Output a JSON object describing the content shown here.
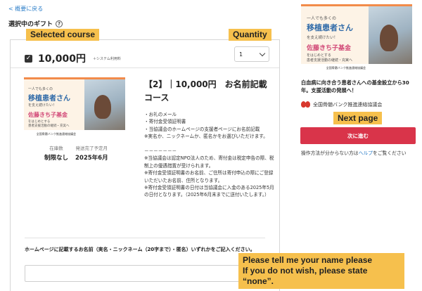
{
  "nav": {
    "back_label": "< 概要に戻る"
  },
  "section": {
    "title": "選択中のギフト",
    "help_icon": "question-circle-icon"
  },
  "annotations": {
    "selected_course": "Selected course",
    "quantity": "Quantity",
    "next_page": "Next page",
    "name_line1": "Please tell me your name please",
    "name_line2": "If you do not wish, please state “none”."
  },
  "course": {
    "checked": true,
    "price": "10,000円",
    "price_note": "＋システム利用料",
    "title": "【2】｜10,000円　お名前記載コース",
    "remaining_label": "在庫数",
    "remaining_value": "制限なし",
    "ship_label": "発送完了予定月",
    "ship_value": "2025年6月",
    "details": "・お礼のメール\n・寄付金受領証明書\n・当協議会のホームページの支援者ページにお名前記載\n※実名か、ニックネームか、匿名かをお選びいただけます。\n\n－－－－－－－\n※当協議会は認定NPO法人のため、寄付金は税定申告の際、税制上の優遇措置が受けられます。\n※寄付金受領証明書のお名前、ご住所は寄付申込の際にご登録いただいたお名前、住所となります。\n※寄付金受領証明書の日付は当協議会に入金のある2025年5月の日付となります。（2025年6月末までに送付いたします。）"
  },
  "quantity": {
    "selected": "1"
  },
  "thumbnail": {
    "line1": "一人でも多くの",
    "line2": "移植患者さん",
    "line3": "を支え続けたい！",
    "line4": "佐藤きち子基金",
    "line5a": "をはじめとする",
    "line5b": "患者支援活動の継続・充実へ",
    "org_short": "全国骨髄バンク推進連絡協議会"
  },
  "name_field": {
    "label": "ホームページに記載するお名前（実名・ニックネーム（20字まで）・匿名）いずれかをご記入ください。",
    "value": "",
    "placeholder": ""
  },
  "sidebar": {
    "description": "白血病に向き合う患者さんへの基金設立から30年。支援活動の発展へ！",
    "org_name": "全国骨髄バンク推進連絡協議会",
    "next_button": "次に進む",
    "help_prefix": "操作方法が分からない方は",
    "help_link": "ヘルプ",
    "help_suffix": "をご覧ください"
  },
  "colors": {
    "accent": "#d9344a",
    "tag": "#f6c04d",
    "link": "#2e7fc9"
  }
}
